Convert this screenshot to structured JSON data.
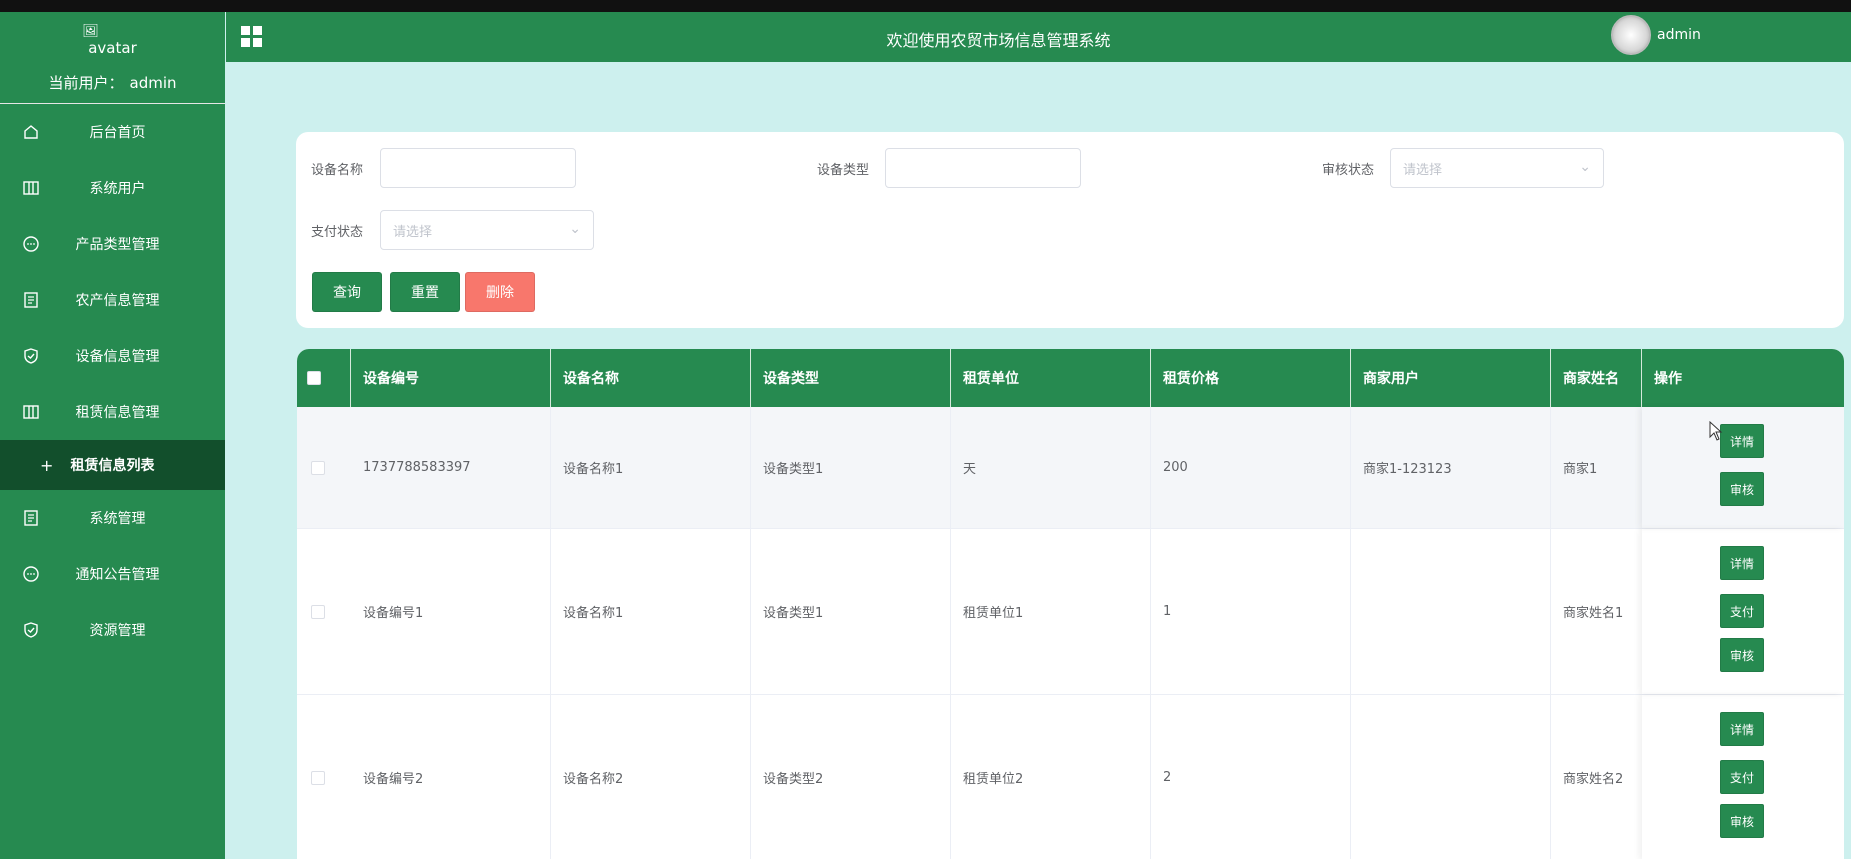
{
  "sidebar": {
    "avatar_alt": "avatar",
    "current_user_label": "当前用户：",
    "current_user": "admin",
    "items": [
      {
        "label": "后台首页",
        "icon": "home-icon"
      },
      {
        "label": "系统用户",
        "icon": "columns-icon"
      },
      {
        "label": "产品类型管理",
        "icon": "chat-icon"
      },
      {
        "label": "农产信息管理",
        "icon": "document-icon"
      },
      {
        "label": "设备信息管理",
        "icon": "shield-check-icon"
      },
      {
        "label": "租赁信息管理",
        "icon": "columns-icon"
      },
      {
        "label": "租赁信息列表",
        "icon": "plus-icon",
        "active": true
      },
      {
        "label": "系统管理",
        "icon": "document-icon"
      },
      {
        "label": "通知公告管理",
        "icon": "chat-icon"
      },
      {
        "label": "资源管理",
        "icon": "shield-check-icon"
      }
    ]
  },
  "header": {
    "title": "欢迎使用农贸市场信息管理系统",
    "user": "admin"
  },
  "search": {
    "device_name_label": "设备名称",
    "device_name_value": "",
    "device_type_label": "设备类型",
    "device_type_value": "",
    "audit_status_label": "审核状态",
    "audit_status_placeholder": "请选择",
    "pay_status_label": "支付状态",
    "pay_status_placeholder": "请选择",
    "query_button": "查询",
    "reset_button": "重置",
    "delete_button": "删除"
  },
  "table": {
    "columns": [
      "设备编号",
      "设备名称",
      "设备类型",
      "租赁单位",
      "租赁价格",
      "商家用户",
      "商家姓名",
      "操作"
    ],
    "rows": [
      {
        "code": "1737788583397",
        "name": "设备名称1",
        "type": "设备类型1",
        "unit": "天",
        "price": "200",
        "merchant_user": "商家1-123123",
        "merchant_name": "商家1",
        "actions": [
          "详情",
          "审核"
        ]
      },
      {
        "code": "设备编号1",
        "name": "设备名称1",
        "type": "设备类型1",
        "unit": "租赁单位1",
        "price": "1",
        "merchant_user": "",
        "merchant_name": "商家姓名1",
        "actions": [
          "详情",
          "支付",
          "审核"
        ]
      },
      {
        "code": "设备编号2",
        "name": "设备名称2",
        "type": "设备类型2",
        "unit": "租赁单位2",
        "price": "2",
        "merchant_user": "",
        "merchant_name": "商家姓名2",
        "actions": [
          "详情",
          "支付",
          "审核"
        ]
      }
    ]
  },
  "colors": {
    "primary": "#268a50",
    "active_menu": "#124f2c",
    "danger": "#f8776c",
    "background": "#cdf0ee"
  }
}
